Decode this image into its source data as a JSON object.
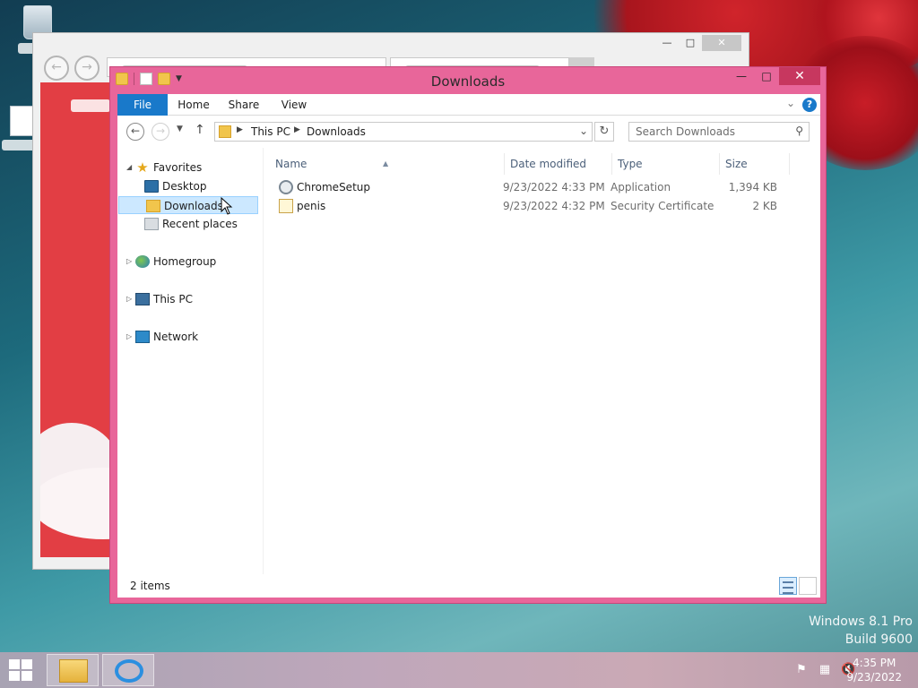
{
  "desktop": {
    "icons": [
      {
        "name": "recycle-bin"
      },
      {
        "name": "data-shortcut"
      }
    ],
    "watermark": {
      "edition": "Windows 8.1 Pro",
      "build": "Build 9600"
    }
  },
  "explorer": {
    "title": "Downloads",
    "ribbon": {
      "file": "File",
      "home": "Home",
      "share": "Share",
      "view": "View",
      "help": "?"
    },
    "address": {
      "crumbs": [
        "This PC",
        "Downloads"
      ]
    },
    "search": {
      "placeholder": "Search Downloads"
    },
    "nav": {
      "favorites": "Favorites",
      "desktop": "Desktop",
      "downloads": "Downloads",
      "recent": "Recent places",
      "homegroup": "Homegroup",
      "thispc": "This PC",
      "network": "Network"
    },
    "columns": {
      "name": "Name",
      "date": "Date modified",
      "type": "Type",
      "size": "Size"
    },
    "files": [
      {
        "name": "ChromeSetup",
        "date": "9/23/2022 4:33 PM",
        "type": "Application",
        "size": "1,394 KB",
        "icon": "application-icon"
      },
      {
        "name": "penis",
        "date": "9/23/2022 4:32 PM",
        "type": "Security Certificate",
        "size": "2 KB",
        "icon": "certificate-icon"
      }
    ],
    "status": "2 items"
  },
  "taskbar": {
    "time": "4:35 PM",
    "date": "9/23/2022",
    "apps": [
      "file-explorer",
      "internet-explorer"
    ]
  },
  "colors": {
    "explorer_frame": "#e8669a",
    "accent": "#1979ca",
    "close_button": "#c7375f",
    "browser_page": "#e23e44"
  }
}
